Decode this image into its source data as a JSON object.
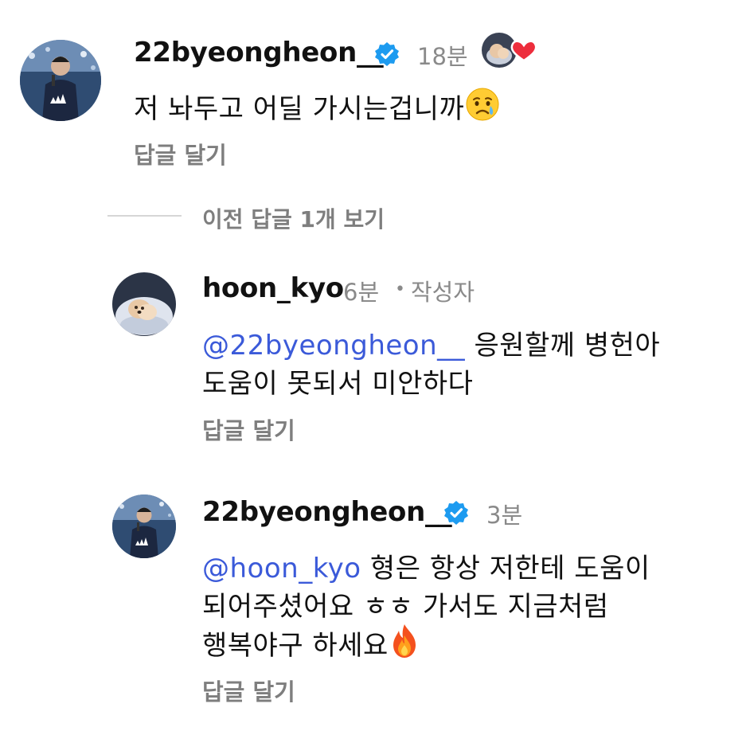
{
  "comments": [
    {
      "username": "22byeongheon__",
      "time": "18분",
      "verified": true,
      "text": "저 놔두고 어딜 가시는겁니까",
      "emoji": "crying-face-emoji",
      "reply_label": "답글 달기"
    }
  ],
  "view_previous_replies": "이전 답글 1개 보기",
  "replies": [
    {
      "username": "hoon_kyo",
      "time": "6분",
      "separator": "•",
      "author_tag": "작성자",
      "mention": "@22byeongheon__",
      "text_line1": " 응원할께 병헌아",
      "text_line2": "도움이 못되서 미안하다",
      "reply_label": "답글 달기"
    },
    {
      "username": "22byeongheon__",
      "time": "3분",
      "verified": true,
      "mention": "@hoon_kyo",
      "text_line1": " 형은 항상 저한테 도움이",
      "text_line2": "되어주셨어요 ㅎㅎ 가서도 지금처럼",
      "text_line3": "행복야구 하세요",
      "emoji": "fire-emoji",
      "reply_label": "답글 달기"
    }
  ],
  "colors": {
    "mention": "#3b5ad9",
    "verified": "#1d9bf0",
    "heart": "#ed2d3c",
    "muted": "#8a8a8a"
  }
}
